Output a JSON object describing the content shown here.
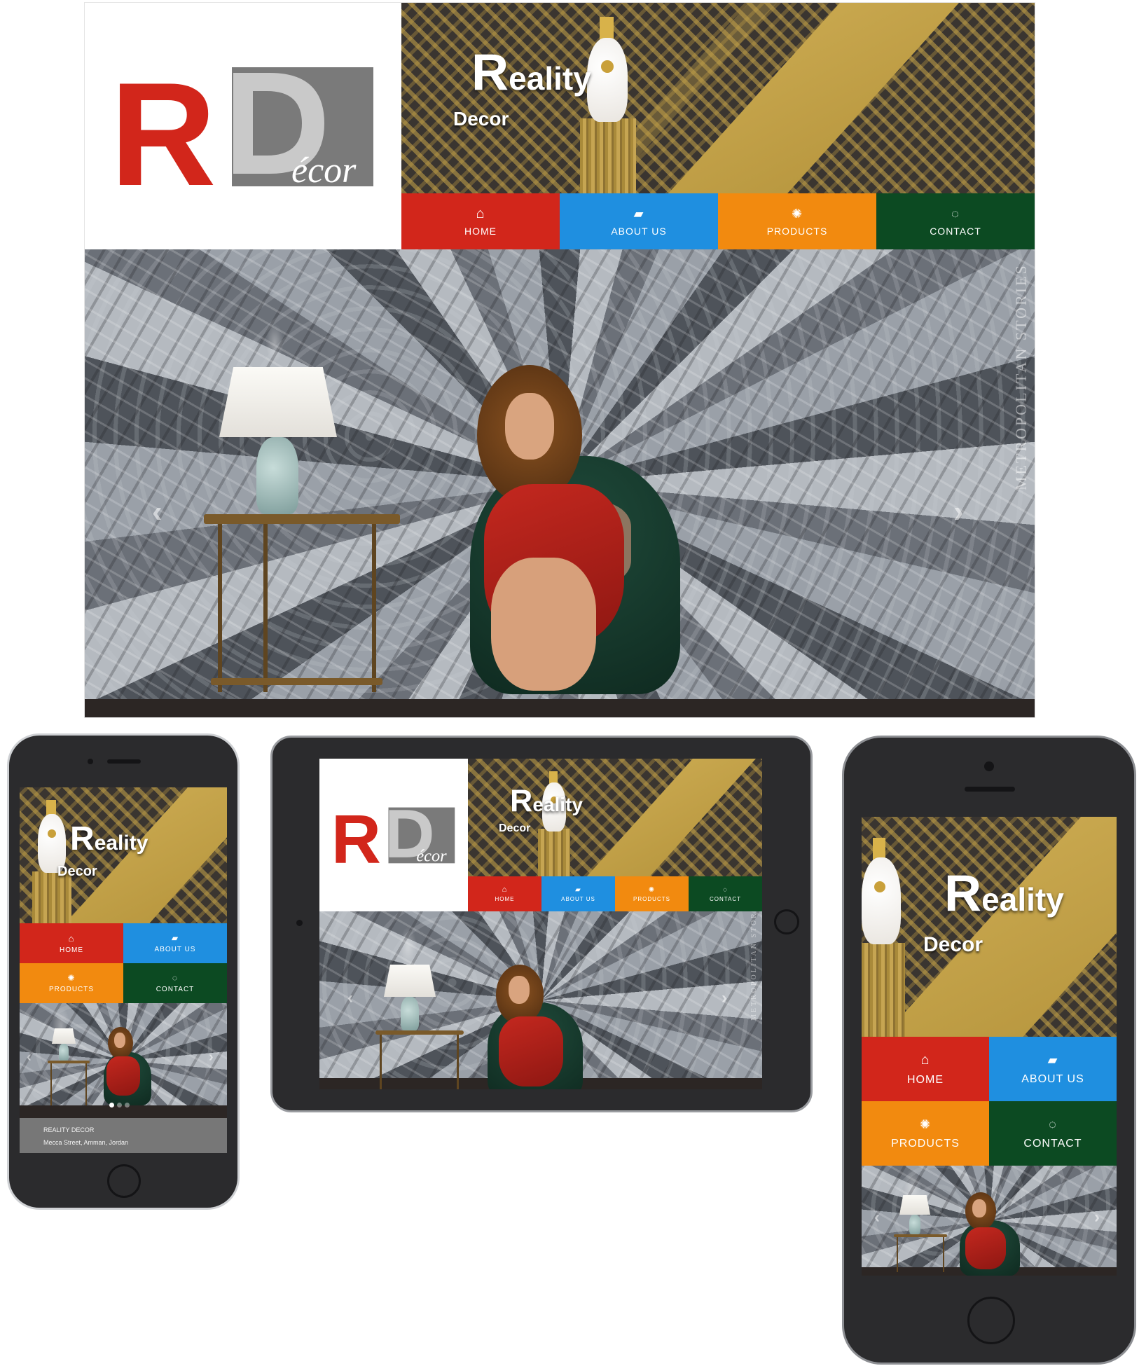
{
  "brand": {
    "logo_letters": "RD",
    "logo_script": "écor",
    "title_initial": "R",
    "title_rest": "eality",
    "subtitle": "Decor"
  },
  "nav": [
    {
      "label": "HOME",
      "icon": "home-icon",
      "color": "#d2261b"
    },
    {
      "label": "ABOUT US",
      "icon": "book-icon",
      "color": "#1f8fe0"
    },
    {
      "label": "PRODUCTS",
      "icon": "loading-icon",
      "color": "#f28a0f"
    },
    {
      "label": "CONTACT",
      "icon": "chat-icon",
      "color": "#0c4a22"
    }
  ],
  "hero": {
    "watermark": "METROPOLITAN STORIES",
    "prev": "‹",
    "next": "›"
  },
  "footer": {
    "company": "REALITY DECOR",
    "address": "Mecca Street, Amman, Jordan"
  },
  "colors": {
    "logo_red": "#d2261b",
    "logo_gray": "#7a7a7a",
    "device_frame": "#2b2b2d"
  }
}
